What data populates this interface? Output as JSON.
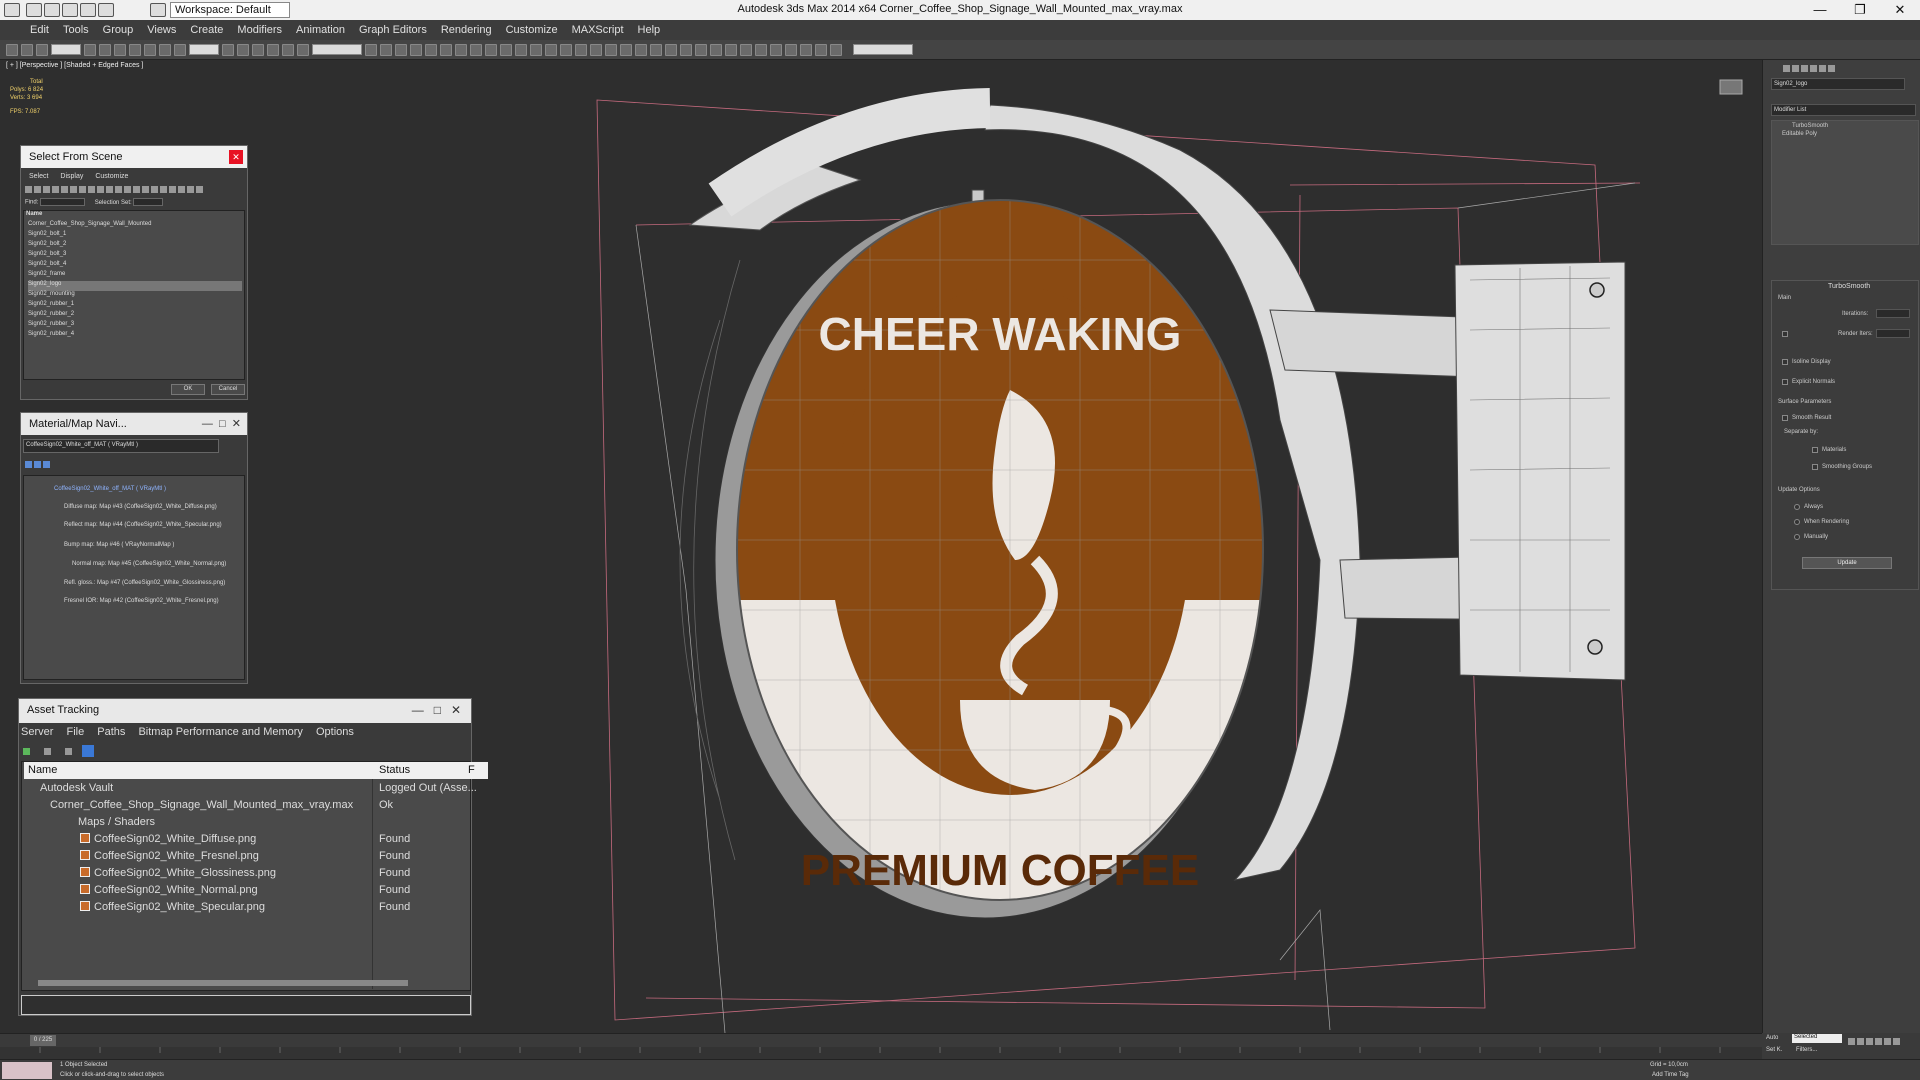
{
  "titlebar": {
    "workspace": "Workspace: Default",
    "title": "Autodesk 3ds Max  2014 x64     Corner_Coffee_Shop_Signage_Wall_Mounted_max_vray.max"
  },
  "menu": [
    "Edit",
    "Tools",
    "Group",
    "Views",
    "Create",
    "Modifiers",
    "Animation",
    "Graph Editors",
    "Rendering",
    "Customize",
    "MAXScript",
    "Help"
  ],
  "viewport": {
    "label": "[ + ] [Perspective ] [Shaded + Edged Faces ]",
    "stats": {
      "total": "Total",
      "polys_label": "Polys:",
      "polys": "6 824",
      "verts_label": "Verts:",
      "verts": "3 694",
      "fps_label": "FPS:",
      "fps": "7.087"
    }
  },
  "sign": {
    "line1": "CHEER WAKING",
    "line2": "PREMIUM COFFEE",
    "brown": "#8a4a12",
    "cream": "#ece7e2"
  },
  "select_scene": {
    "title": "Select From Scene",
    "tabs": [
      "Select",
      "Display",
      "Customize"
    ],
    "find_label": "Find:",
    "selection_set": "Selection Set:",
    "column": "Name",
    "items": [
      "Corner_Coffee_Shop_Signage_Wall_Mounted",
      "Sign02_bolt_1",
      "Sign02_bolt_2",
      "Sign02_bolt_3",
      "Sign02_bolt_4",
      "Sign02_frame",
      "Sign02_logo",
      "Sign02_mounting",
      "Sign02_rubber_1",
      "Sign02_rubber_2",
      "Sign02_rubber_3",
      "Sign02_rubber_4"
    ],
    "ok": "OK",
    "cancel": "Cancel"
  },
  "mat_nav": {
    "title": "Material/Map Navi...",
    "field": "CoffeeSign02_White_off_MAT  ( VRayMtl )",
    "items": [
      "CoffeeSign02_White_off_MAT  ( VRayMtl )",
      "Diffuse map: Map #43 (CoffeeSign02_White_Diffuse.png)",
      "Reflect map: Map #44 (CoffeeSign02_White_Specular.png)",
      "Bump map: Map #46  ( VRayNormalMap )",
      "Normal map: Map #45 (CoffeeSign02_White_Normal.png)",
      "Refl. gloss.: Map #47 (CoffeeSign02_White_Glossiness.png)",
      "Fresnel IOR: Map #42 (CoffeeSign02_White_Fresnel.png)"
    ]
  },
  "asset_tracking": {
    "title": "Asset Tracking",
    "menu": [
      "Server",
      "File",
      "Paths",
      "Bitmap Performance and Memory",
      "Options"
    ],
    "col_name": "Name",
    "col_status": "Status",
    "col_extra": "F",
    "rows": [
      {
        "name": "Autodesk Vault",
        "status": "Logged Out (Asse..."
      },
      {
        "name": "Corner_Coffee_Shop_Signage_Wall_Mounted_max_vray.max",
        "status": "Ok"
      },
      {
        "name": "Maps / Shaders",
        "status": ""
      },
      {
        "name": "CoffeeSign02_White_Diffuse.png",
        "status": "Found"
      },
      {
        "name": "CoffeeSign02_White_Fresnel.png",
        "status": "Found"
      },
      {
        "name": "CoffeeSign02_White_Glossiness.png",
        "status": "Found"
      },
      {
        "name": "CoffeeSign02_White_Normal.png",
        "status": "Found"
      },
      {
        "name": "CoffeeSign02_White_Specular.png",
        "status": "Found"
      }
    ]
  },
  "cmd_panel": {
    "object_name": "Sign02_logo",
    "modifier_list": "Modifier List",
    "stack": [
      "TurboSmooth",
      "Editable Poly"
    ],
    "rollout_title": "TurboSmooth",
    "main": "Main",
    "iterations": "Iterations:",
    "render_iters": "Render Iters:",
    "isoline": "Isoline Display",
    "explicit_normals": "Explicit Normals",
    "surface_params": "Surface Parameters",
    "smooth_result": "Smooth Result",
    "separate_by": "Separate by:",
    "materials": "Materials",
    "smoothing_groups": "Smoothing Groups",
    "update_options": "Update Options",
    "always": "Always",
    "when_rendering": "When Rendering",
    "manually": "Manually",
    "update": "Update"
  },
  "timeline": {
    "frame": "0 / 225"
  },
  "status": {
    "selected": "1 Object Selected",
    "prompt": "Click or click-and-drag to select objects",
    "grid": "Grid = 10,0cm",
    "auto": "Auto",
    "selected_dd": "Selected",
    "set_key": "Set K.",
    "filters": "Filters...",
    "add_time_tag": "Add Time Tag"
  }
}
